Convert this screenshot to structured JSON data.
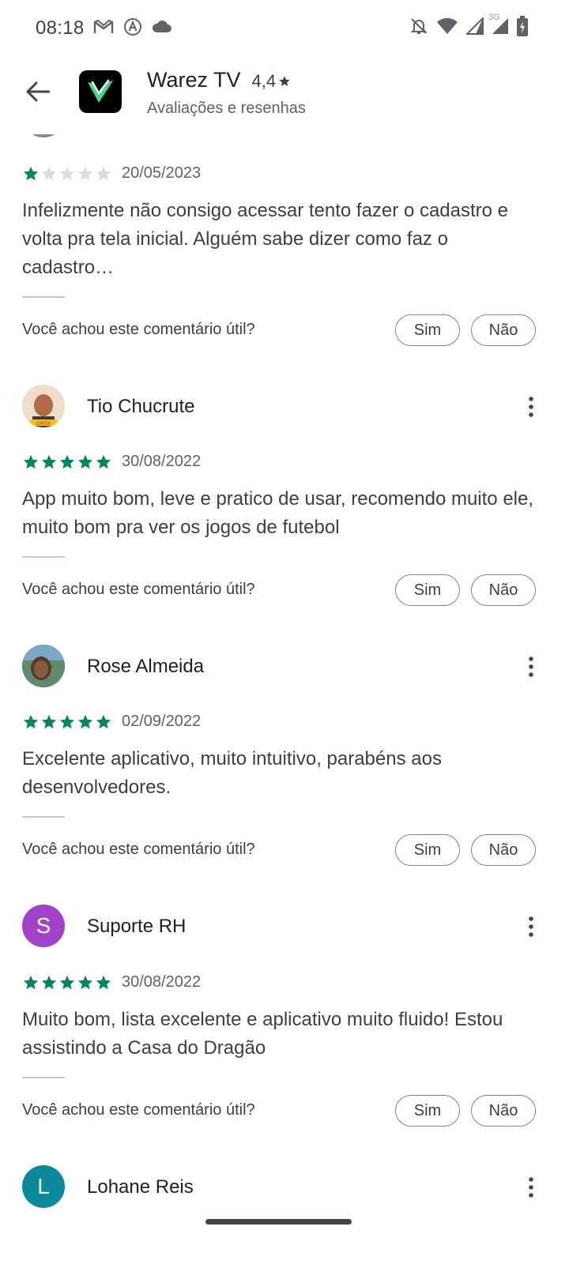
{
  "status_bar": {
    "time": "08:18",
    "left_icons": [
      "gmail-icon",
      "auto-a-icon",
      "cloud-icon"
    ],
    "network_label": "3G",
    "right_icons": [
      "mute-icon",
      "wifi-icon",
      "signal-icon",
      "signal-3g-icon",
      "battery-icon"
    ]
  },
  "header": {
    "app_name": "Warez TV",
    "rating": "4,4",
    "rating_icon": "star-icon",
    "subtitle": "Avaliações e resenhas",
    "back_icon": "arrow-back-icon"
  },
  "colors": {
    "star_filled": "#01875f",
    "star_empty": "#dadce0",
    "avatar_suporte": "#a142c8",
    "avatar_lohane": "#0a8a9b"
  },
  "helpful": {
    "question": "Você achou este comentário útil?",
    "yes": "Sim",
    "no": "Não"
  },
  "reviews": [
    {
      "name": "",
      "stars": 1,
      "date": "20/05/2023",
      "text": "Infelizmente não consigo acessar tento fazer o cadastro e volta pra tela inicial. Alguém sabe dizer como faz o cadastro…"
    },
    {
      "name": "Tio Chucrute",
      "avatar_caption": "GRITA",
      "stars": 5,
      "date": "30/08/2022",
      "text": "App muito bom, leve e pratico de usar, recomendo muito ele, muito bom pra ver os jogos de futebol"
    },
    {
      "name": "Rose Almeida",
      "stars": 5,
      "date": "02/09/2022",
      "text": "Excelente aplicativo, muito intuitivo, parabéns aos desenvolvedores."
    },
    {
      "name": "Suporte RH",
      "avatar_letter": "S",
      "stars": 5,
      "date": "30/08/2022",
      "text": "Muito bom, lista excelente e aplicativo muito fluido! Estou assistindo a Casa do Dragão"
    },
    {
      "name": "Lohane Reis",
      "avatar_letter": "L"
    }
  ]
}
